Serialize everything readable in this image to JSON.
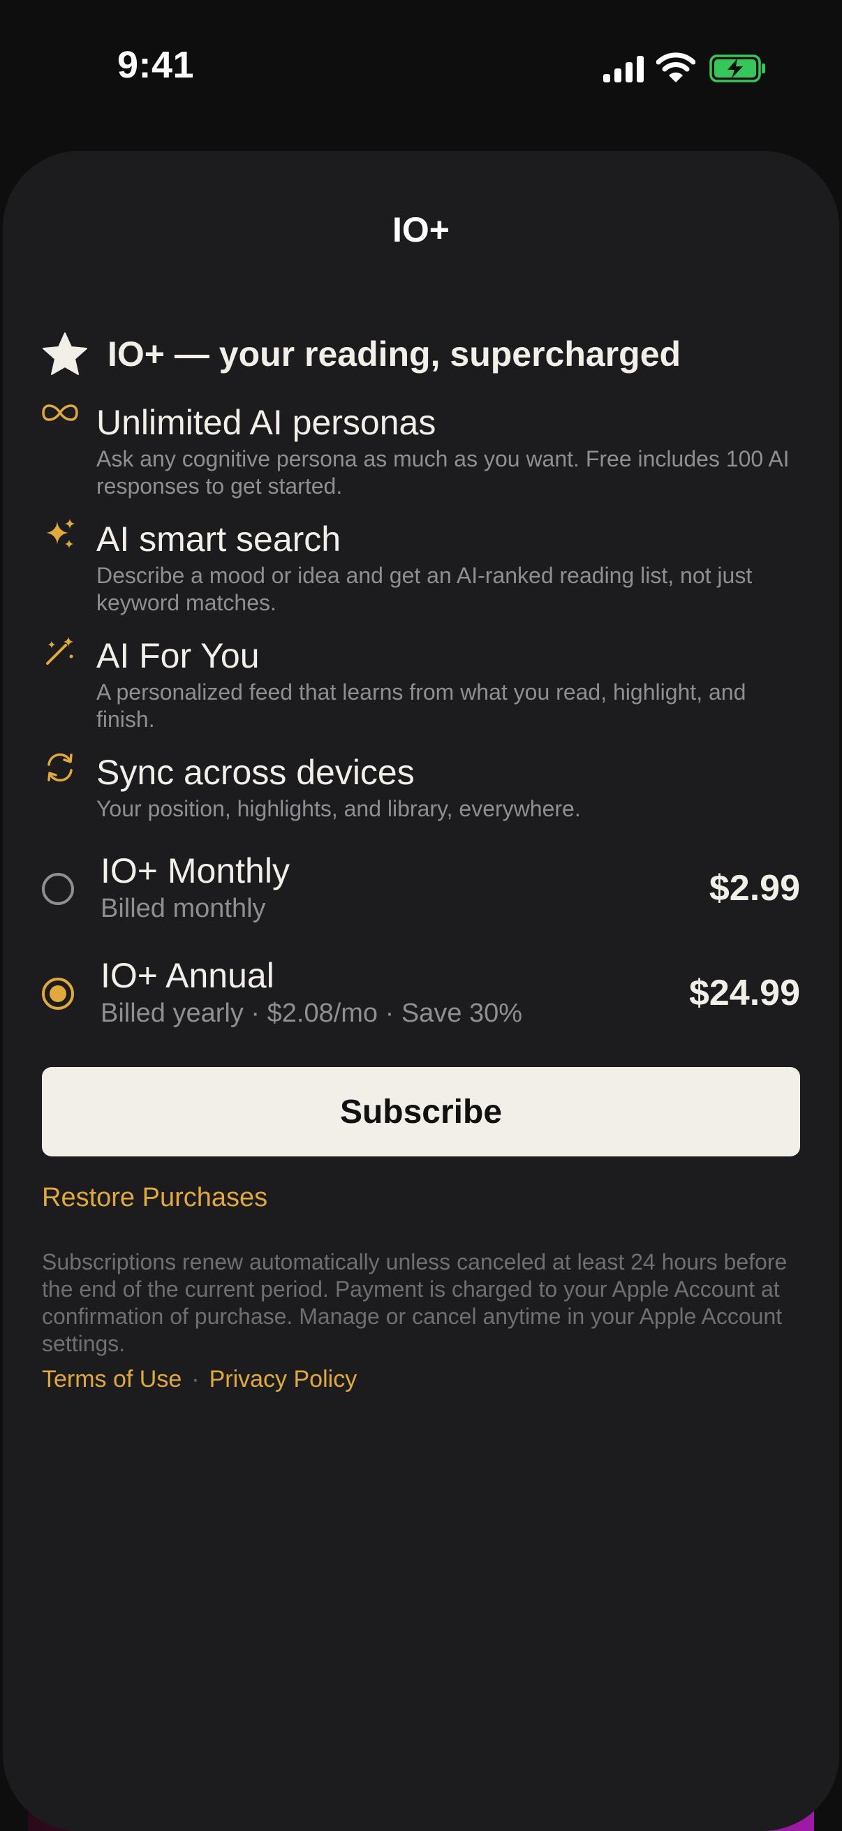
{
  "status_bar": {
    "time": "9:41",
    "icons": [
      "signal-icon",
      "wifi-icon",
      "battery-charging-icon"
    ]
  },
  "sheet": {
    "title": "IO+"
  },
  "hero": {
    "icon": "star-icon",
    "title": "IO+ — your reading, supercharged"
  },
  "features": [
    {
      "icon": "infinity-icon",
      "title": "Unlimited AI personas",
      "description": "Ask any cognitive persona as much as you want. Free includes 100 AI responses to get started."
    },
    {
      "icon": "sparkles-icon",
      "title": "AI smart search",
      "description": "Describe a mood or idea and get an AI-ranked reading list, not just keyword matches."
    },
    {
      "icon": "magic-wand-icon",
      "title": "AI For You",
      "description": "A personalized feed that learns from what you read, highlight, and finish."
    },
    {
      "icon": "sync-icon",
      "title": "Sync across devices",
      "description": "Your position, highlights, and library, everywhere."
    }
  ],
  "plans": [
    {
      "name": "IO+ Monthly",
      "subtitle": "Billed monthly",
      "price": "$2.99",
      "selected": false
    },
    {
      "name": "IO+ Annual",
      "subtitle": "Billed yearly · $2.08/mo · Save 30%",
      "price": "$24.99",
      "selected": true
    }
  ],
  "subscribe_label": "Subscribe",
  "restore_label": "Restore Purchases",
  "legal_text": "Subscriptions renew automatically unless canceled at least 24 hours before the end of the current period. Payment is charged to your Apple Account at confirmation of purchase. Manage or cancel anytime in your Apple Account settings.",
  "legal_links": {
    "terms": "Terms of Use",
    "separator": "·",
    "privacy": "Privacy Policy"
  },
  "colors": {
    "accent": "#e0a93a",
    "sheet_background": "#1c1c1e",
    "button_background": "#f2efe9",
    "battery": "#34c759"
  }
}
